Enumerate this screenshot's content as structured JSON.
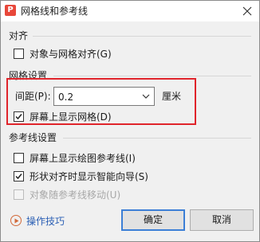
{
  "dialog": {
    "title": "网格线和参考线",
    "app_icon_glyph": "P",
    "close_icon": "close-icon"
  },
  "align_section": {
    "title": "对齐",
    "snap_to_grid": {
      "label": "对象与网格对齐(G)",
      "checked": false
    }
  },
  "grid_section": {
    "title": "网格设置",
    "spacing_label": "间距(P):",
    "spacing_value": "0.2",
    "unit": "厘米",
    "show_grid": {
      "label": "屏幕上显示网格(D)",
      "checked": true
    },
    "highlight_color": "#e0242b"
  },
  "guide_section": {
    "title": "参考线设置",
    "show_drawing_guides": {
      "label": "屏幕上显示绘图参考线(I)",
      "checked": false
    },
    "smart_guides": {
      "label": "形状对齐时显示智能向导(S)",
      "checked": true
    },
    "move_with_guides": {
      "label": "对象随参考线移动(U)",
      "checked": false,
      "disabled": true
    }
  },
  "footer": {
    "tips_label": "操作技巧",
    "ok_label": "确定",
    "cancel_label": "取消"
  },
  "colors": {
    "accent": "#3c7fd6",
    "link": "#2b5fb4",
    "title_icon": "#e8473a"
  }
}
